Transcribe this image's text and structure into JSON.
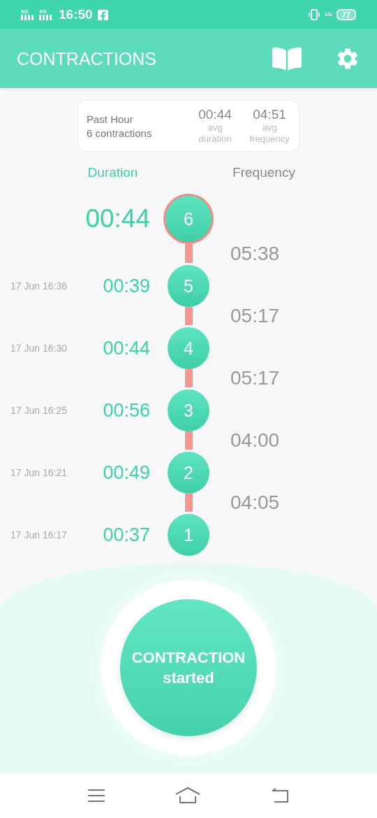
{
  "status_bar": {
    "networks": [
      "4G",
      "4G"
    ],
    "time": "16:50",
    "data_network": "4G",
    "battery": "77"
  },
  "app_bar": {
    "title": "CONTRACTIONS"
  },
  "summary": {
    "period": "Past Hour",
    "count": "6 contractions",
    "stats": [
      {
        "value": "00:44",
        "label": "avg duration"
      },
      {
        "value": "04:51",
        "label": "avg frequency"
      }
    ]
  },
  "columns": [
    {
      "label": "Duration",
      "selected": true
    },
    {
      "label": "Frequency",
      "selected": false
    }
  ],
  "entries": [
    {
      "kind": "current",
      "number": "6",
      "duration": "00:44",
      "frequency": "05:38"
    },
    {
      "kind": "past",
      "date": "17 Jun 16:36",
      "number": "5",
      "duration": "00:39",
      "frequency": "05:17"
    },
    {
      "kind": "past",
      "date": "17 Jun 16:30",
      "number": "4",
      "duration": "00:44",
      "frequency": "05:17"
    },
    {
      "kind": "past",
      "date": "17 Jun 16:25",
      "number": "3",
      "duration": "00:56",
      "frequency": "04:00"
    },
    {
      "kind": "past",
      "date": "17 Jun 16:21",
      "number": "2",
      "duration": "00:49",
      "frequency": "04:05"
    },
    {
      "kind": "past",
      "date": "17 Jun 16:17",
      "number": "1",
      "duration": "00:37"
    }
  ],
  "action_button": {
    "title": "CONTRACTION",
    "subtitle": "started"
  }
}
